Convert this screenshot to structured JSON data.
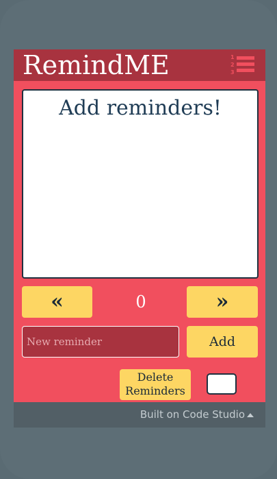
{
  "app": {
    "title": "RemindME",
    "display_text": "Add reminders!",
    "counter": "0",
    "prev_label": "«",
    "next_label": "»",
    "input_placeholder": "New reminder",
    "input_value": "",
    "add_label": "Add",
    "delete_label": "Delete Reminders"
  },
  "footer": {
    "text": "Built on Code Studio"
  },
  "colors": {
    "app_bg": "#f14f5e",
    "header_bg": "#a8333f",
    "button_bg": "#fdd663",
    "text_dark": "#1f3c55"
  },
  "icons": {
    "menu": "numbered-list-icon",
    "footer_caret": "caret-up-icon"
  }
}
